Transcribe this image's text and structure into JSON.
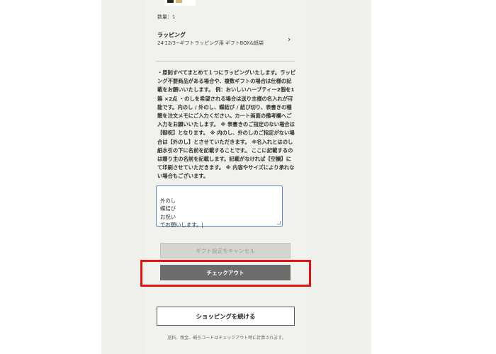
{
  "cart": {
    "quantity_label": "数量：1",
    "wrapping": {
      "title": "ラッピング",
      "selection": "24'12/3~ギフトラッピング用 ギフトBOX&紙袋",
      "icon": "chevron-right-icon"
    }
  },
  "gift": {
    "instructions": "・原則すべてまとめて１つにラッピングいたします。ラッピング不要商品がある場合や、複数ギフトの場合は仕様の記載をお願いいたします。 例：おいしいハーブティー2個を1箱 ×2点 ・のしを希望される場合は送り主様の名入れが可能です。内のし / 外のし、蝶結び / 結び切り、表書きの種類を注文メモにご入力ください。カート画面の備考欄へご入力をお願いいたします。 ※ 表書きのご指定のない場合は【御祝】となります。 ※ 内のし、外のしのご指定がない場合は【外のし】とさせていただきます。 ※名入れとはのし紙水引の下に名前を記載することです。 ここに記載するのは贈り主の名前を記載します。記載がなければ【空欄】にて印刷させていただきます。 ※ 内容やサイズにより承れない場合もございます。",
    "memo_value": "外のし\n蝶結び\nお祝い\nでお願いします。|",
    "cancel_label": "ギフト設定をキャンセル"
  },
  "actions": {
    "checkout_label": "チェックアウト",
    "continue_label": "ショッピングを続ける",
    "footnote": "送料、税金、割引コードはチェックアウト時に計算されます。"
  },
  "colors": {
    "highlight": "#e81212",
    "checkout_bg": "#6c6c6c",
    "panel_bg": "#f1f1ee"
  }
}
